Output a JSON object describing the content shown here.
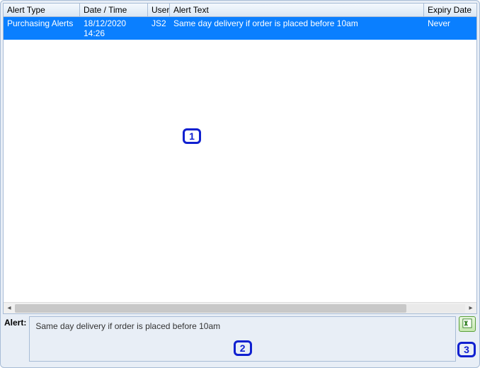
{
  "table": {
    "headers": {
      "alert_type": "Alert Type",
      "date_time": "Date / Time",
      "user": "User",
      "alert_text": "Alert Text",
      "expiry_date": "Expiry Date"
    },
    "rows": [
      {
        "alert_type": "Purchasing Alerts",
        "date_time": "18/12/2020 14:26",
        "user": "JS2",
        "alert_text": "Same day delivery if order is placed before 10am",
        "expiry_date": "Never"
      }
    ]
  },
  "detail": {
    "label": "Alert:",
    "value": "Same day delivery if order is placed before 10am"
  },
  "callouts": {
    "c1": "1",
    "c2": "2",
    "c3": "3"
  }
}
